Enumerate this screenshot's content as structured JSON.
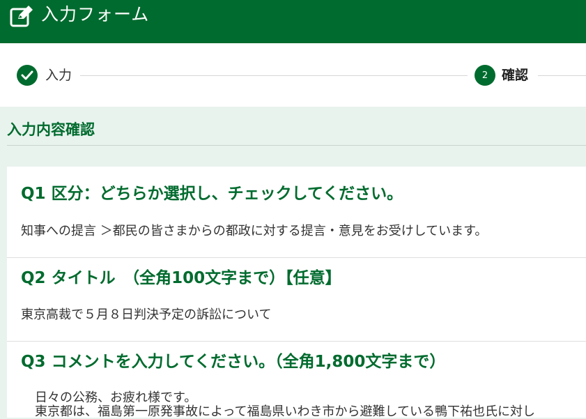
{
  "header": {
    "title": "入力フォーム",
    "icon": "edit-icon"
  },
  "steps": [
    {
      "label": "入力",
      "state": "done",
      "icon": "check-icon"
    },
    {
      "number": "2",
      "label": "確認",
      "state": "current"
    }
  ],
  "section": {
    "title": "入力内容確認"
  },
  "questions": [
    {
      "title": "Q1 区分：どちらか選択し、チェックしてください。",
      "answer": "知事への提言 ＞都民の皆さまからの都政に対する提言・意見をお受けしています。"
    },
    {
      "title": "Q2 タイトル　（全角100文字まで）【任意】",
      "answer": "東京高裁で５月８日判決予定の訴訟について"
    },
    {
      "title": "Q3 コメントを入力してください。（全角1,800文字まで）",
      "answer_lines": [
        "日々の公務、お疲れ様です。",
        "東京都は、福島第一原発事故によって福島県いわき市から避難している鴨下祐也氏に対し"
      ]
    }
  ],
  "colors": {
    "brand": "#006b2e",
    "background": "#e9f3ee"
  }
}
